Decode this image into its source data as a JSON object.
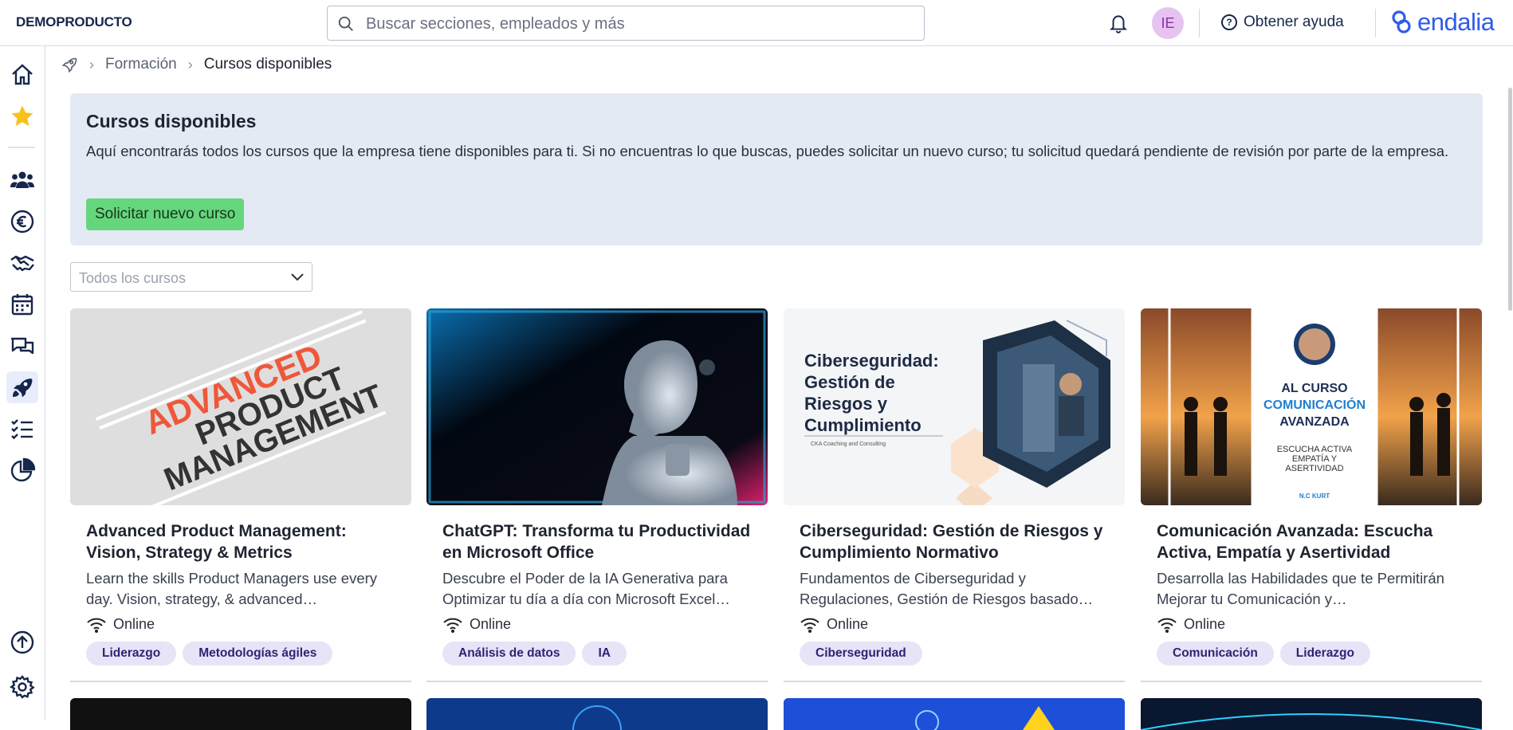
{
  "header": {
    "company": "DEMOPRODUCTO",
    "search_placeholder": "Buscar secciones, empleados y más",
    "avatar_initials": "IE",
    "help_label": "Obtener ayuda",
    "logo_text": "endalia",
    "brand_color": "#2f5bea"
  },
  "breadcrumb": {
    "section": "Formación",
    "current": "Cursos disponibles"
  },
  "banner": {
    "title": "Cursos disponibles",
    "text": "Aquí encontrarás todos los cursos que la empresa tiene disponibles para ti. Si no encuentras lo que buscas, puedes solicitar un nuevo curso; tu solicitud quedará pendiente de revisión por parte de la empresa.",
    "button": "Solicitar nuevo curso"
  },
  "filter": {
    "selected": "Todos los cursos"
  },
  "courses": [
    {
      "thumb_lines": [
        "ADVANCED",
        "PRODUCT",
        "MANAGEMENT"
      ],
      "title": "Advanced Product Management: Vision, Strategy & Metrics",
      "desc": "Learn the skills Product Managers use every day. Vision, strategy, & advanced…",
      "mode": "Online",
      "tags": [
        "Liderazgo",
        "Metodologías ágiles"
      ]
    },
    {
      "title": "ChatGPT: Transforma tu Productividad en Microsoft Office",
      "desc": "Descubre el Poder de la IA Generativa para Optimizar tu día a día con Microsoft Excel…",
      "mode": "Online",
      "tags": [
        "Análisis de datos",
        "IA"
      ]
    },
    {
      "thumb_lines": [
        "Ciberseguridad:",
        "Gestión de",
        "Riesgos y",
        "Cumplimiento"
      ],
      "thumb_sub": "CKA Coaching and Consulting",
      "title": "Ciberseguridad: Gestión de Riesgos y Cumplimiento Normativo",
      "desc": "Fundamentos de Ciberseguridad y Regulaciones, Gestión de Riesgos basado…",
      "mode": "Online",
      "tags": [
        "Ciberseguridad"
      ]
    },
    {
      "thumb_lines": [
        "AL CURSO",
        "COMUNICACIÓN",
        "AVANZADA"
      ],
      "thumb_sub_lines": [
        "ESCUCHA ACTIVA",
        "EMPATÍA Y",
        "ASERTIVIDAD"
      ],
      "thumb_author": "N.C KURT",
      "title": "Comunicación Avanzada: Escucha Activa, Empatía y Asertividad",
      "desc": "Desarrolla las Habilidades que te Permitirán Mejorar tu Comunicación y…",
      "mode": "Online",
      "tags": [
        "Comunicación",
        "Liderazgo"
      ]
    }
  ],
  "sidebar": {
    "items": [
      "home-icon",
      "star-icon",
      "people-icon",
      "euro-icon",
      "handshake-icon",
      "calendar-icon",
      "chat-icon",
      "rocket-icon",
      "checklist-icon",
      "pie-chart-icon",
      "upload-icon",
      "settings-icon"
    ],
    "active": "rocket-icon"
  }
}
